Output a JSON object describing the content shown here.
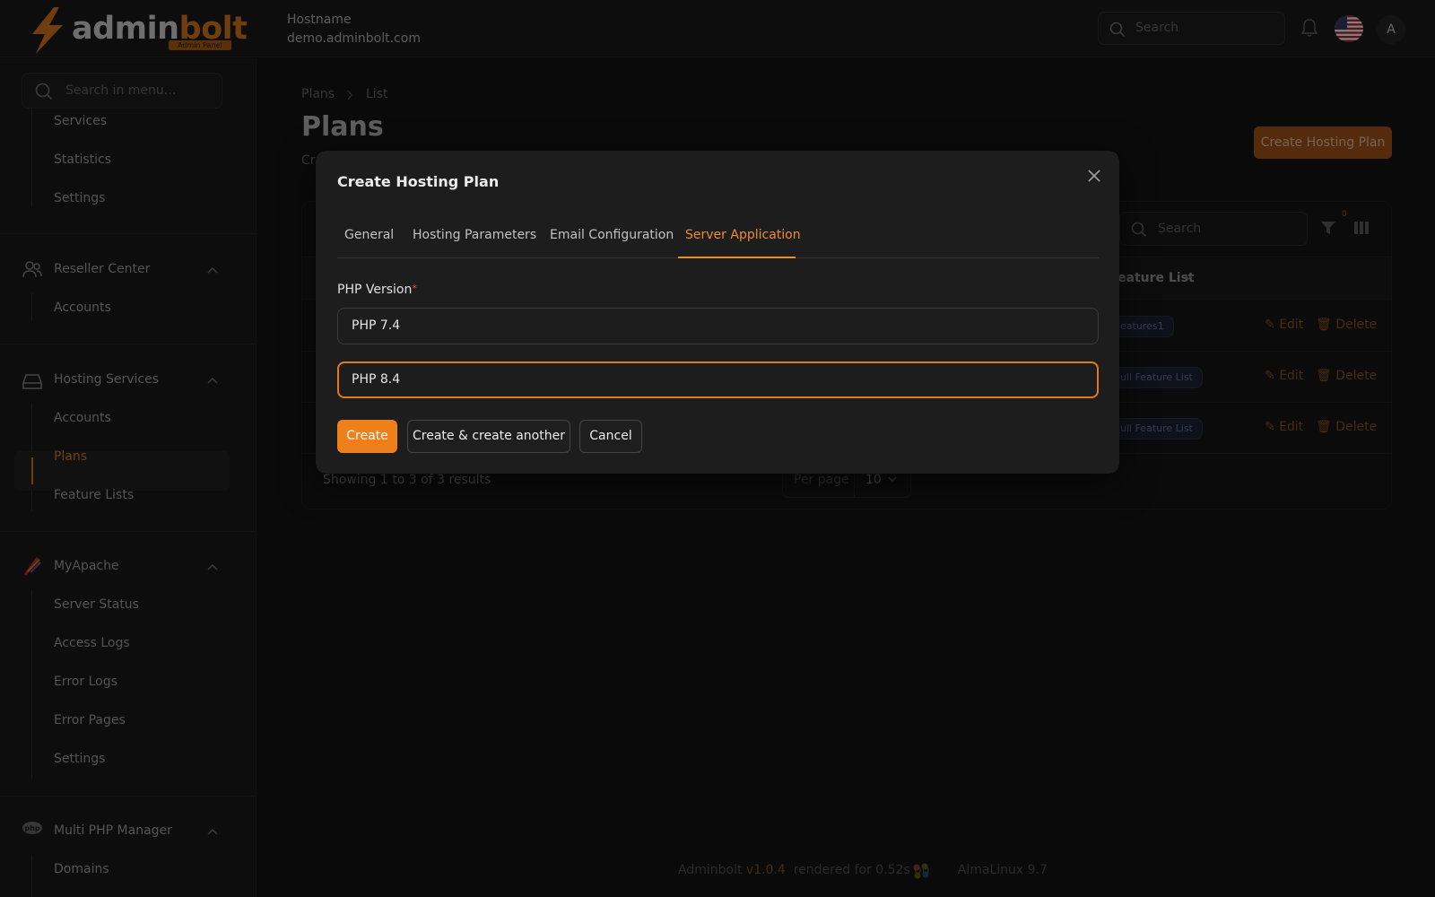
{
  "header": {
    "logo_admin": "admin",
    "logo_bolt": "bolt",
    "logo_badge": "Admin Panel",
    "hostname_label": "Hostname",
    "hostname_value": "demo.adminbolt.com",
    "search_placeholder": "Search",
    "avatar_initial": "A"
  },
  "sidebar": {
    "search_placeholder": "Search in menu...",
    "items_top": [
      "Services",
      "Statistics",
      "Settings"
    ],
    "reseller": {
      "title": "Reseller Center",
      "items": [
        "Accounts"
      ]
    },
    "hosting": {
      "title": "Hosting Services",
      "items": [
        "Accounts",
        "Plans",
        "Feature Lists"
      ]
    },
    "myapache": {
      "title": "MyApache",
      "items": [
        "Server Status",
        "Access Logs",
        "Error Logs",
        "Error Pages",
        "Settings"
      ]
    },
    "multiphp": {
      "title": "Multi PHP Manager",
      "items": [
        "Domains"
      ]
    }
  },
  "main": {
    "breadcrumb": [
      "Plans",
      "List"
    ],
    "title": "Plans",
    "description": "Cr",
    "create_button": "Create Hosting Plan",
    "table": {
      "search_placeholder": "Search",
      "filter_count": "0",
      "column_feature_list": "eature List",
      "rows": [
        {
          "feature": "eatures1",
          "edit": "Edit",
          "delete": "Delete"
        },
        {
          "feature": "ull Feature List",
          "edit": "Edit",
          "delete": "Delete"
        },
        {
          "feature": "ull Feature List",
          "edit": "Edit",
          "delete": "Delete"
        }
      ],
      "showing": "Showing 1 to 3 of 3 results",
      "per_page_label": "Per page",
      "per_page_value": "10"
    }
  },
  "footer": {
    "brand": "Adminbolt",
    "version": "v1.0.4",
    "rendered": "rendered for 0.52s on",
    "os": "AlmaLinux 9.7"
  },
  "modal": {
    "title": "Create Hosting Plan",
    "tabs": [
      "General",
      "Hosting Parameters",
      "Email Configuration",
      "Server Application"
    ],
    "active_tab": "Server Application",
    "field_label": "PHP Version",
    "required_mark": "*",
    "values": [
      "PHP 7.4",
      "PHP 8.4"
    ],
    "buttons": {
      "create": "Create",
      "create_another": "Create & create another",
      "cancel": "Cancel"
    }
  },
  "colors": {
    "accent": "#ef7f1a",
    "background": "#141414",
    "panel": "#1d1d1d"
  }
}
